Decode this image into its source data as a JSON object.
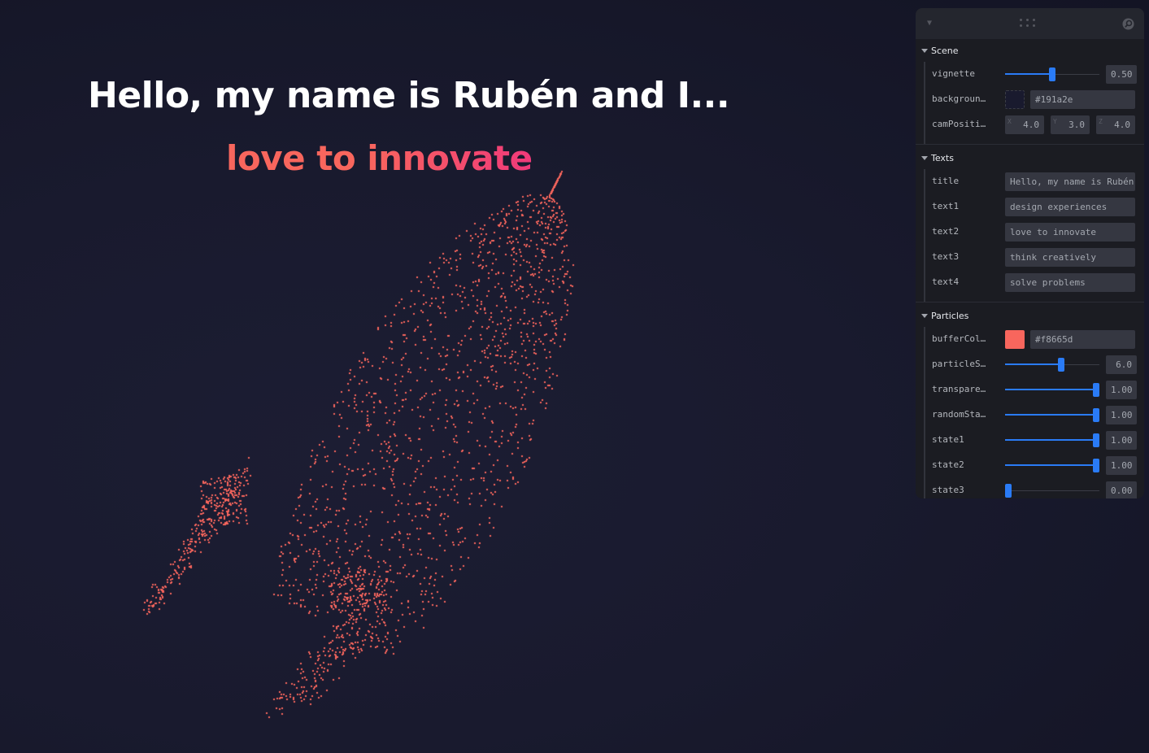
{
  "heading": {
    "title": "Hello, my name is Rubén and I...",
    "subtitle": "love to innovate"
  },
  "colors": {
    "background": "#191a2e",
    "particle": "#f8665d",
    "accent": "#2a7bf6"
  },
  "panel": {
    "icons": [
      "chevron-down-icon",
      "drag-handle-icon",
      "search-icon"
    ],
    "scene": {
      "title": "Scene",
      "vignette": {
        "label": "vignette",
        "value": "0.50",
        "fraction": 0.5
      },
      "background": {
        "label": "backgroun…",
        "value": "#191a2e",
        "swatch": "#191a2e"
      },
      "camPosition": {
        "label": "camPositi…",
        "x_axis": "X",
        "y_axis": "Y",
        "z_axis": "Z",
        "x": "4.0",
        "y": "3.0",
        "z": "4.0"
      }
    },
    "texts": {
      "title": "Texts",
      "rows": [
        {
          "label": "title",
          "value": "Hello, my name is Rubén"
        },
        {
          "label": "text1",
          "value": "design experiences"
        },
        {
          "label": "text2",
          "value": "love to innovate"
        },
        {
          "label": "text3",
          "value": "think creatively"
        },
        {
          "label": "text4",
          "value": "solve problems"
        }
      ]
    },
    "particles": {
      "title": "Particles",
      "bufferColor": {
        "label": "bufferCol…",
        "value": "#f8665d",
        "swatch": "#f8665d"
      },
      "sliders": [
        {
          "label": "particleS…",
          "value": "6.0",
          "fraction": 0.6
        },
        {
          "label": "transpare…",
          "value": "1.00",
          "fraction": 1.0
        },
        {
          "label": "randomSta…",
          "value": "1.00",
          "fraction": 1.0
        },
        {
          "label": "state1",
          "value": "1.00",
          "fraction": 1.0
        },
        {
          "label": "state2",
          "value": "1.00",
          "fraction": 1.0
        },
        {
          "label": "state3",
          "value": "0.00",
          "fraction": 0.0
        }
      ]
    }
  }
}
